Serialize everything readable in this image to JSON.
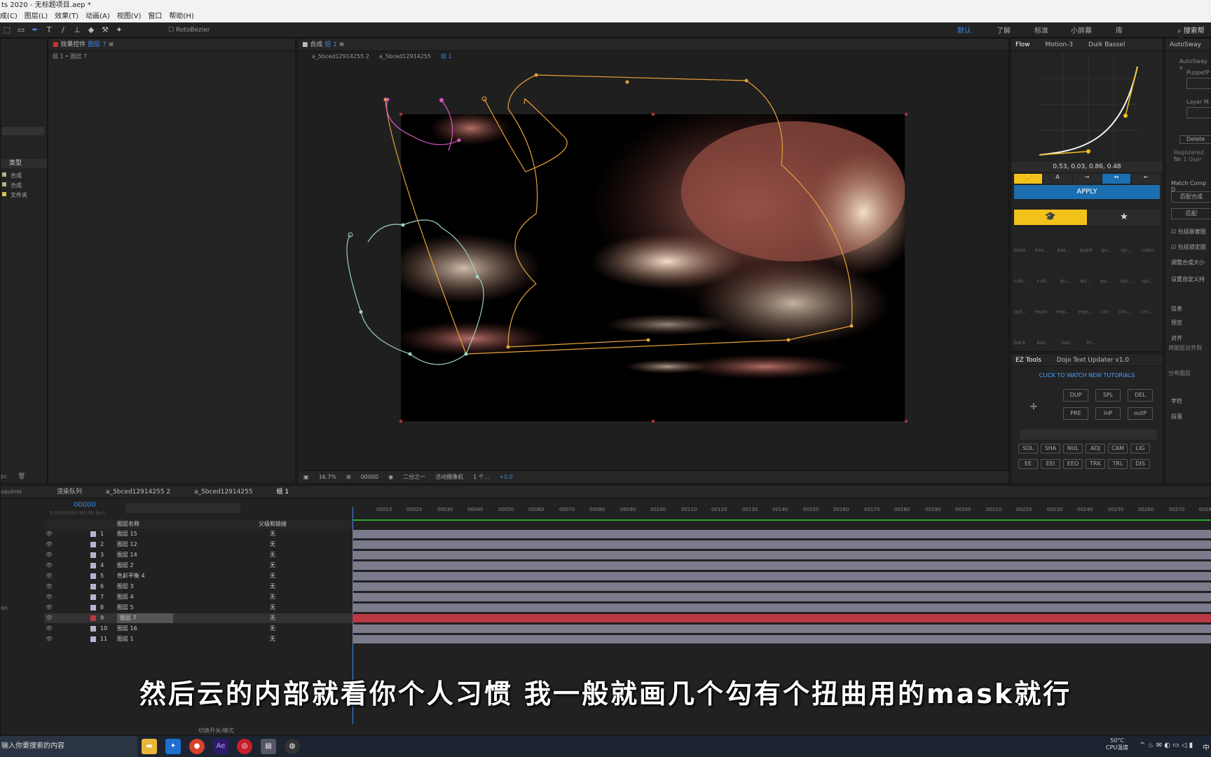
{
  "title": "ts 2020 - 无标题项目.aep *",
  "menu": [
    "成(C)",
    "图层(L)",
    "效果(T)",
    "动画(A)",
    "视图(V)",
    "窗口",
    "帮助(H)"
  ],
  "toolbar": {
    "rotobezier": "RotoBezier",
    "search": "搜索帮助"
  },
  "workspaces": [
    "默认",
    "了解",
    "标准",
    "小屏幕",
    "库"
  ],
  "effects_panel": {
    "title": "效果控件",
    "layer": "图层 7",
    "breadcrumb": "组 1 • 图层 7"
  },
  "project_panel": {
    "col_type": "类型",
    "rows": [
      "合成",
      "合成",
      "文件夹"
    ]
  },
  "comp_panel": {
    "title": "合成",
    "comp": "组 1",
    "tabs": [
      "a_5bced12914255 2",
      "a_5bced12914255",
      "组 1"
    ]
  },
  "viewer_bar": {
    "zoom": "16.7%",
    "timecode": "00000",
    "resolution": "二分之一",
    "camera": "活动摄像机",
    "views": "1 个...",
    "exposure": "+0.0"
  },
  "flow_panel": {
    "tabs": [
      "Flow",
      "Motion-3",
      "Duik Bassel"
    ],
    "values": "0.53, 0.03, 0.86, 0.48",
    "apply": "APPLY",
    "presets_row1": [
      "ease",
      "eas...",
      "eas...",
      "quad",
      "qu...",
      "qu...",
      "cubic"
    ],
    "presets_row2": [
      "cub...",
      "cub...",
      "qu...",
      "qu...",
      "qu...",
      "qui...",
      "qui..."
    ],
    "presets_row3": [
      "qui...",
      "expo",
      "exp...",
      "exp...",
      "circ",
      "circ...",
      "circ..."
    ],
    "presets_row4": [
      "back",
      "bac...",
      "bac...",
      "lin..."
    ]
  },
  "ez_panel": {
    "tabs": [
      "EZ Tools",
      "Dojo Text Updater v1.0"
    ],
    "link": "CLICK TO WATCH NEW TUTORIALS",
    "buttons1": [
      "DUP",
      "SPL",
      "DEL"
    ],
    "buttons2": [
      "PRE",
      "InP",
      "outP"
    ],
    "row1": [
      "SOL",
      "SHA",
      "NUL",
      "ADJ",
      "CAM",
      "LIG"
    ],
    "row2": [
      "EE",
      "EEI",
      "EEO",
      "TRK",
      "TRL",
      "DIS"
    ]
  },
  "autosway": {
    "title": "AutoSway",
    "items": [
      "AutoSway v",
      "PuppetP",
      "Layer M",
      "Delete",
      "Registered to",
      "for 1 User",
      "Match Comp D",
      "匹配合成",
      "匹配",
      "包括嵌套图",
      "包括锁定图",
      "调整合成大小",
      "设置自定义持",
      "信息",
      "预览",
      "对齐",
      "将图层对齐到",
      "分布图层",
      "字符",
      "段落"
    ]
  },
  "timeline": {
    "tabs": [
      "渲染队列",
      "a_5bced12914255 2",
      "a_5bced12914255",
      "组 1"
    ],
    "timecode": "00000",
    "timecode_sub": "0:00:00:00 (60.00 fps)",
    "col_name": "图层名称",
    "col_parent": "父级和链接",
    "toggle_mode": "切换开关/模式",
    "ruler": [
      "00010",
      "00020",
      "00030",
      "00040",
      "00050",
      "00060",
      "00070",
      "00080",
      "00090",
      "00100",
      "00110",
      "00120",
      "00130",
      "00140",
      "00150",
      "00160",
      "00170",
      "00180",
      "00190",
      "00200",
      "00210",
      "00220",
      "00230",
      "00240",
      "00250",
      "00260",
      "00270",
      "00280"
    ],
    "layers": [
      {
        "n": "1",
        "name": "图层 15",
        "parent": "无"
      },
      {
        "n": "2",
        "name": "图层 12",
        "parent": "无"
      },
      {
        "n": "3",
        "name": "图层 14",
        "parent": "无"
      },
      {
        "n": "4",
        "name": "图层 2",
        "parent": "无"
      },
      {
        "n": "5",
        "name": "色彩平衡 4",
        "parent": "无"
      },
      {
        "n": "6",
        "name": "图层 3",
        "parent": "无"
      },
      {
        "n": "7",
        "name": "图层 4",
        "parent": "无"
      },
      {
        "n": "8",
        "name": "图层 5",
        "parent": "无"
      },
      {
        "n": "9",
        "name": "图层 7",
        "parent": "无"
      },
      {
        "n": "10",
        "name": "图层 16",
        "parent": "无"
      },
      {
        "n": "11",
        "name": "图层 1",
        "parent": "无"
      }
    ]
  },
  "left_misc": {
    "a": "squirrel",
    "b": "on",
    "c": "pc"
  },
  "subtitle": "然后云的内部就看你个人习惯 我一般就画几个勾有个扭曲用的mask就行",
  "taskbar": {
    "search": "输入你要搜索的内容",
    "temp": "50°C",
    "cpu": "CPU温度",
    "lang": "中"
  },
  "colors": {
    "accent": "#3b86e6",
    "mask_orange": "#e8a23a",
    "mask_pink": "#d659c3",
    "mask_teal": "#9fd3c5",
    "flow_yellow": "#f2c21b",
    "flow_blue": "#1b6fb0",
    "selected_bar": "#b83844"
  }
}
